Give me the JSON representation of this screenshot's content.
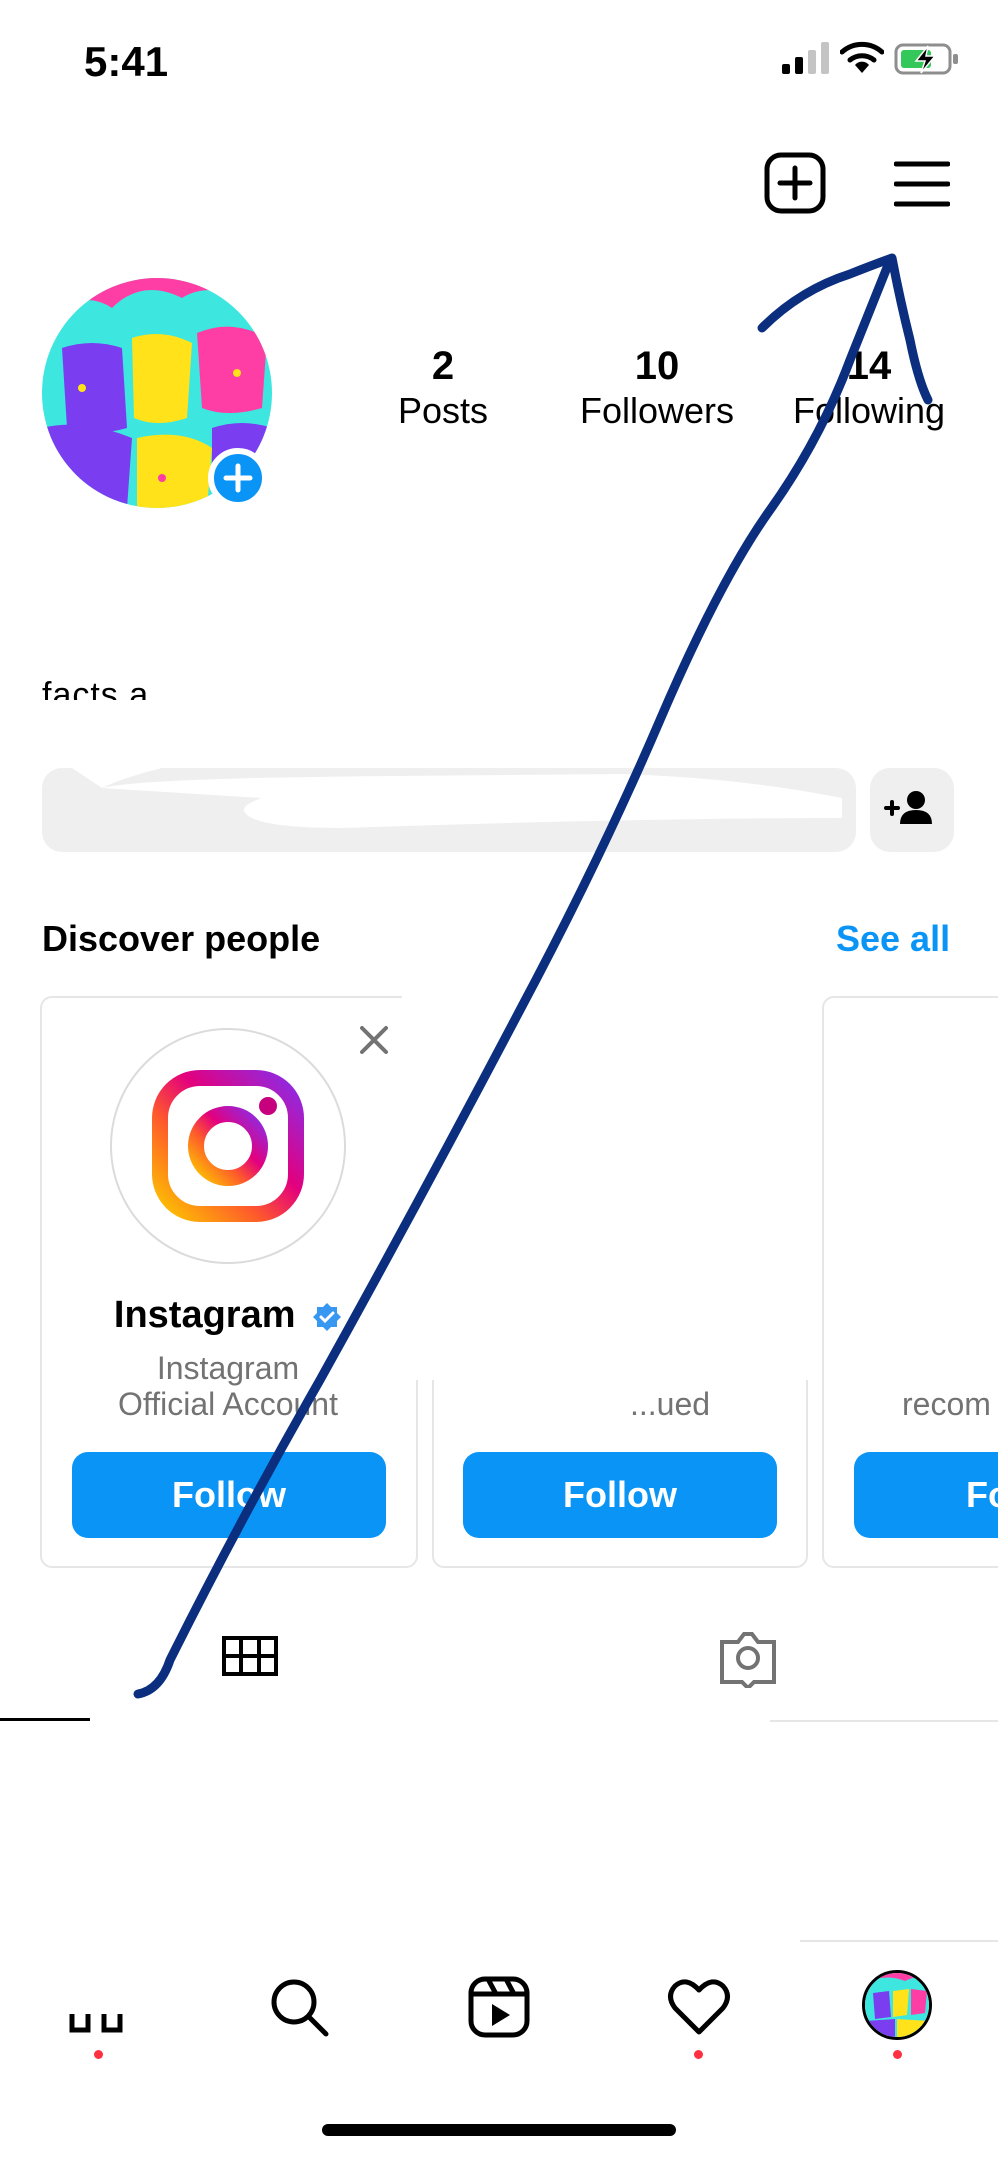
{
  "status_bar": {
    "time": "5:41"
  },
  "profile": {
    "stats": [
      {
        "value": "2",
        "label": "Posts"
      },
      {
        "value": "10",
        "label": "Followers"
      },
      {
        "value": "14",
        "label": "Following"
      }
    ],
    "bio_partial": "facts a"
  },
  "discover": {
    "title": "Discover people",
    "see_all": "See all",
    "cards": [
      {
        "name": "Instagram",
        "verified": true,
        "sub_line1": "Instagram",
        "sub_line2": "Official Account",
        "follow_label": "Follow"
      },
      {
        "name": "",
        "sub_line2": "...ued",
        "follow_label": "Follow"
      },
      {
        "name": "",
        "sub_line2": "recom",
        "follow_label": "Fo"
      }
    ]
  },
  "colors": {
    "accent": "#0a95f6",
    "notification": "#ff3040",
    "scribble": "#0b2f7e"
  },
  "icons": {
    "new_post": "plus-square-icon",
    "menu": "hamburger-menu-icon",
    "add_person": "add-person-icon",
    "grid": "grid-icon",
    "tagged": "tagged-photo-icon",
    "nav": [
      "home-icon",
      "search-icon",
      "reels-icon",
      "heart-icon",
      "profile-avatar"
    ]
  }
}
